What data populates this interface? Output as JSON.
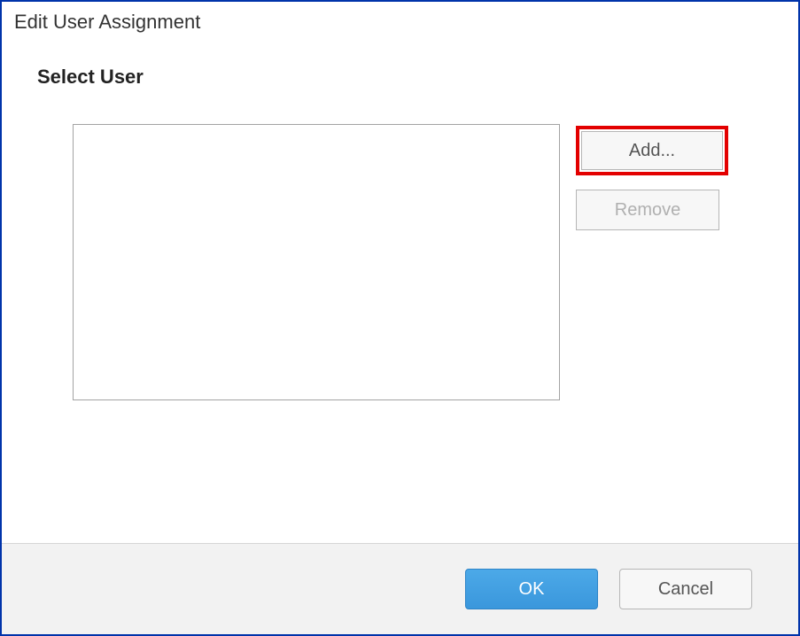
{
  "dialog": {
    "title": "Edit User Assignment",
    "section_heading": "Select User"
  },
  "buttons": {
    "add": "Add...",
    "remove": "Remove",
    "ok": "OK",
    "cancel": "Cancel"
  },
  "users": []
}
